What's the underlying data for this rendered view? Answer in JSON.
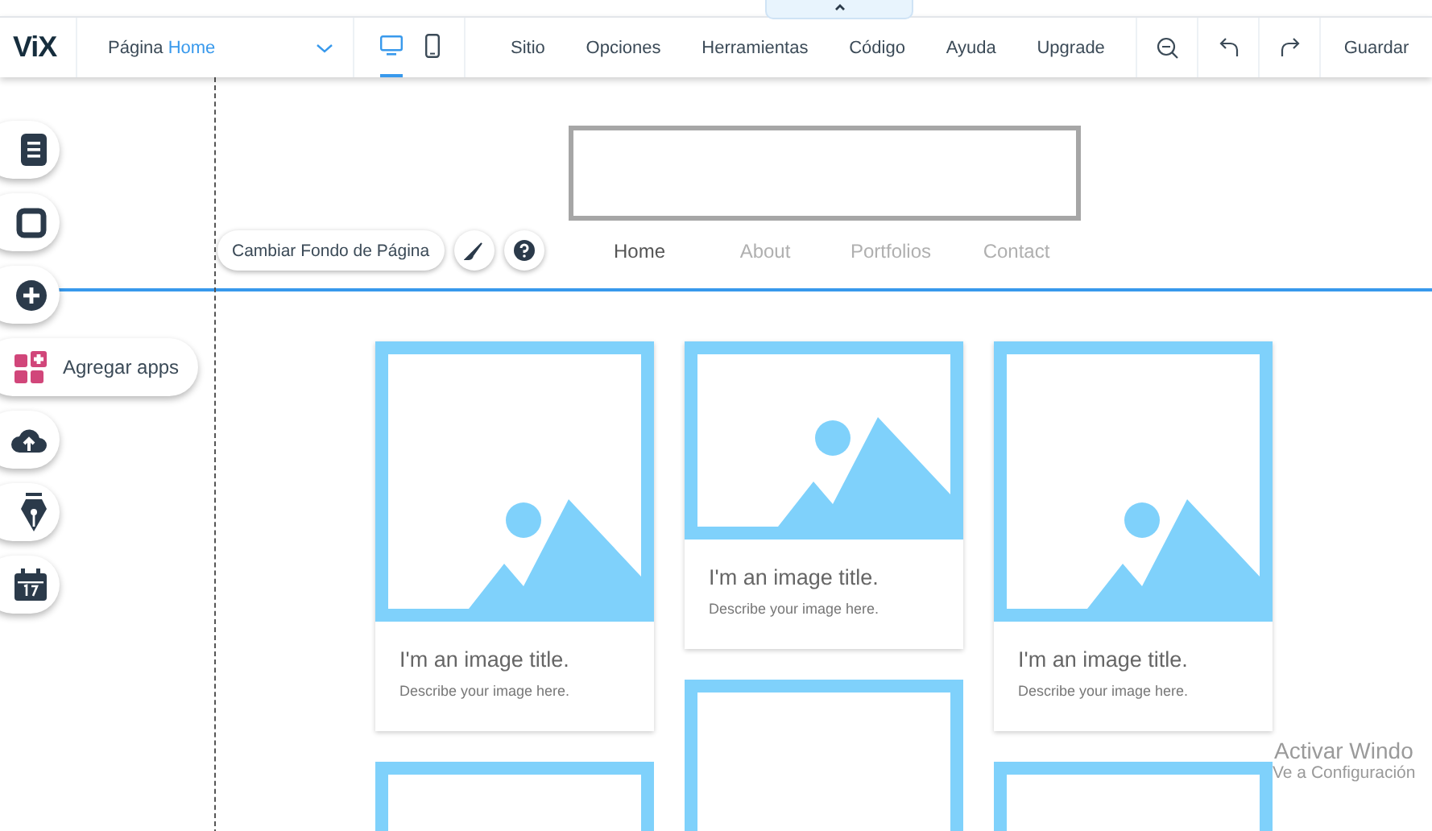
{
  "editor_bar": {
    "logo": "ViX",
    "page_label": "Página",
    "page_name": "Home",
    "views": [
      {
        "kind": "desktop",
        "selected": true
      },
      {
        "kind": "mobile",
        "selected": false
      }
    ],
    "menu": [
      "Sitio",
      "Opciones",
      "Herramientas",
      "Código",
      "Ayuda",
      "Upgrade"
    ],
    "save": "Guardar"
  },
  "left_rail": [
    {
      "kind": "pages"
    },
    {
      "kind": "background"
    },
    {
      "kind": "add"
    },
    {
      "kind": "apps",
      "label": "Agregar apps"
    },
    {
      "kind": "upload"
    },
    {
      "kind": "pen"
    },
    {
      "kind": "calendar"
    }
  ],
  "background_button": "Cambiar Fondo de Página",
  "site_header": {
    "nav": [
      {
        "label": "Home",
        "selected": true
      },
      {
        "label": "About",
        "selected": false
      },
      {
        "label": "Portfolios",
        "selected": false
      },
      {
        "label": "Contact",
        "selected": false
      }
    ]
  },
  "gallery": [
    {
      "items": [
        {
          "kind": "tall",
          "title": "I'm an image title.",
          "description": "Describe your image here."
        },
        {
          "kind": "partial"
        }
      ]
    },
    {
      "items": [
        {
          "kind": "short",
          "title": "I'm an image title.",
          "description": "Describe your image here."
        },
        {
          "kind": "partial"
        }
      ]
    },
    {
      "items": [
        {
          "kind": "tall",
          "title": "I'm an image title.",
          "description": "Describe your image here."
        },
        {
          "kind": "partial"
        }
      ]
    }
  ],
  "os_notice": {
    "title": "Activar Windo",
    "subtitle": "Ve a Configuración"
  }
}
